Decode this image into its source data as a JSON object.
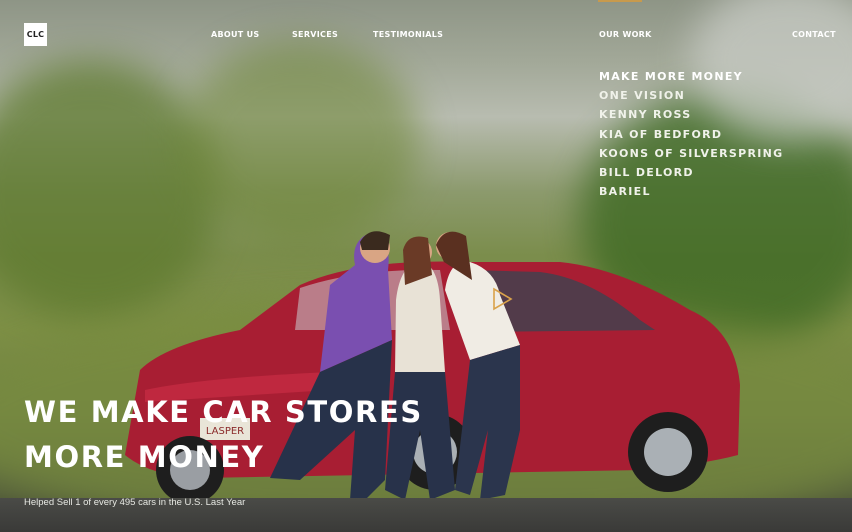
{
  "brand": {
    "logo_text": "CLC"
  },
  "nav": {
    "items": [
      {
        "label": "ABOUT US"
      },
      {
        "label": "SERVICES"
      },
      {
        "label": "TESTIMONIALS"
      },
      {
        "label": "OUR WORK"
      },
      {
        "label": "CONTACT"
      }
    ]
  },
  "our_work_menu": {
    "items": [
      {
        "label": "MAKE MORE MONEY"
      },
      {
        "label": "ONE VISION"
      },
      {
        "label": "KENNY ROSS"
      },
      {
        "label": "KIA OF BEDFORD"
      },
      {
        "label": "KOONS OF SILVERSPRING"
      },
      {
        "label": "BILL DELORD"
      },
      {
        "label": "BARIEL"
      }
    ]
  },
  "hero": {
    "headline_line1": "WE MAKE CAR STORES",
    "headline_line2": "MORE MONEY",
    "tagline": "Helped Sell 1 of every 495 cars in the U.S. Last Year",
    "plate_text": "LASPER",
    "play_icon": "play-icon"
  },
  "colors": {
    "accent": "#c79a4d",
    "car_red": "#b3223a",
    "text": "#ffffff"
  }
}
